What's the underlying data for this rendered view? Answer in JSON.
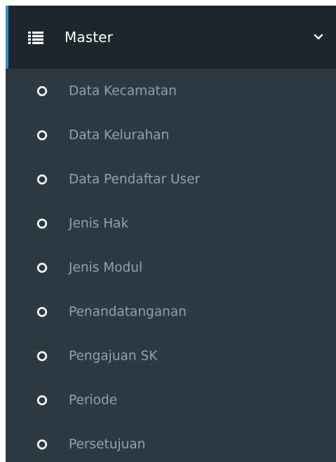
{
  "menu": {
    "title": "Master",
    "icon": "list-icon",
    "expanded": true,
    "accent_color": "#3c8dbc",
    "items": [
      {
        "label": "Data Kecamatan",
        "icon": "circle-outline-icon"
      },
      {
        "label": "Data Kelurahan",
        "icon": "circle-outline-icon"
      },
      {
        "label": "Data Pendaftar User",
        "icon": "circle-outline-icon"
      },
      {
        "label": "Jenis Hak",
        "icon": "circle-outline-icon"
      },
      {
        "label": "Jenis Modul",
        "icon": "circle-outline-icon"
      },
      {
        "label": "Penandatanganan",
        "icon": "circle-outline-icon"
      },
      {
        "label": "Pengajuan SK",
        "icon": "circle-outline-icon"
      },
      {
        "label": "Periode",
        "icon": "circle-outline-icon"
      },
      {
        "label": "Persetujuan",
        "icon": "circle-outline-icon"
      }
    ]
  }
}
